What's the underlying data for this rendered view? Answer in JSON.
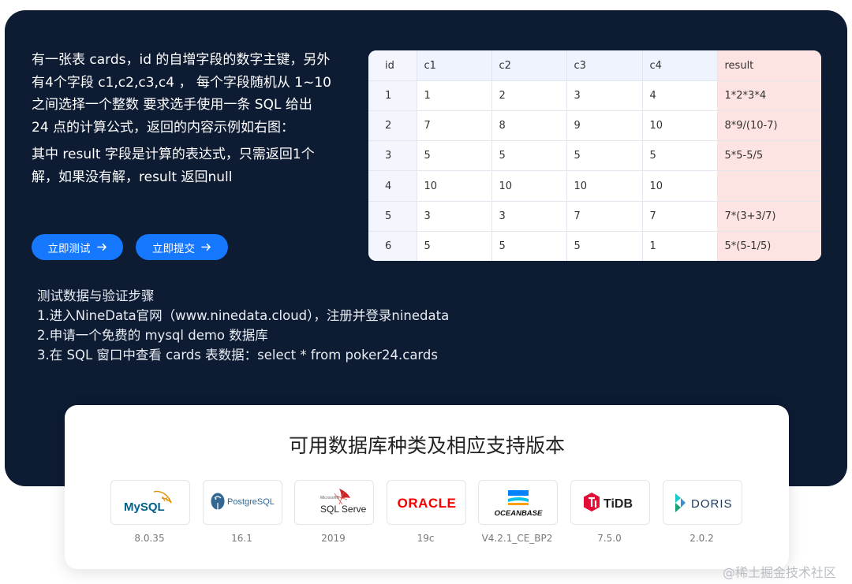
{
  "intro": {
    "para1": "有一张表 cards，id 的自增字段的数字主键，另外有4个字段 c1,c2,c3,c4 ， 每个字段随机从 1~10 之间选择一个整数 要求选手使用一条 SQL 给出 24 点的计算公式，返回的内容示例如右图：",
    "para2": "其中 result 字段是计算的表达式，只需返回1个解，如果没有解，result 返回null"
  },
  "buttons": {
    "test": "立即测试",
    "submit": "立即提交"
  },
  "table": {
    "headers": [
      "id",
      "c1",
      "c2",
      "c3",
      "c4",
      "result"
    ],
    "rows": [
      [
        "1",
        "1",
        "2",
        "3",
        "4",
        "1*2*3*4"
      ],
      [
        "2",
        "7",
        "8",
        "9",
        "10",
        "8*9/(10-7)"
      ],
      [
        "3",
        "5",
        "5",
        "5",
        "5",
        "5*5-5/5"
      ],
      [
        "4",
        "10",
        "10",
        "10",
        "10",
        ""
      ],
      [
        "5",
        "3",
        "3",
        "7",
        "7",
        "7*(3+3/7)"
      ],
      [
        "6",
        "5",
        "5",
        "5",
        "1",
        "5*(5-1/5)"
      ]
    ]
  },
  "steps": [
    "测试数据与验证步骤",
    "1.进入NineData官网（www.ninedata.cloud），注册并登录ninedata",
    "2.申请一个免费的 mysql demo 数据库",
    "3.在 SQL 窗口中查看 cards 表数据：select * from poker24.cards"
  ],
  "databases": {
    "title": "可用数据库种类及相应支持版本",
    "items": [
      {
        "name": "MySQL",
        "version": "8.0.35",
        "icon": "mysql-logo"
      },
      {
        "name": "PostgreSQL",
        "version": "16.1",
        "icon": "postgresql-logo"
      },
      {
        "name": "SQL Server",
        "version": "2019",
        "icon": "sqlserver-logo"
      },
      {
        "name": "ORACLE",
        "version": "19c",
        "icon": "oracle-logo"
      },
      {
        "name": "OCEANBASE",
        "version": "V4.2.1_CE_BP2",
        "icon": "oceanbase-logo"
      },
      {
        "name": "TiDB",
        "version": "7.5.0",
        "icon": "tidb-logo"
      },
      {
        "name": "DORIS",
        "version": "2.0.2",
        "icon": "doris-logo"
      }
    ]
  },
  "watermark": "@稀土掘金技术社区",
  "colors": {
    "panel": "#0d1b33",
    "accent": "#1677ff",
    "result_bg": "#fde3e1",
    "header_bg": "#eef3fd"
  }
}
